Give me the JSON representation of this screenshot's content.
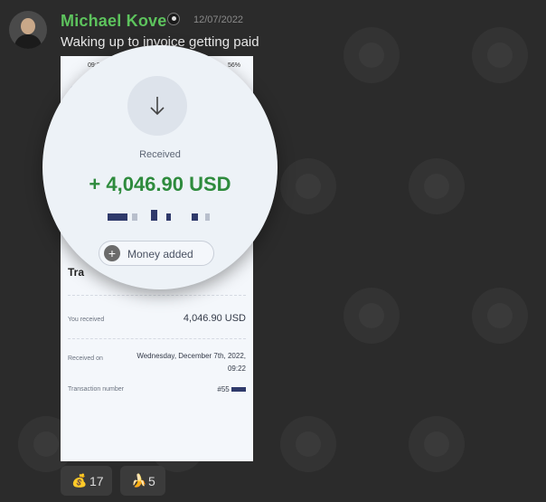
{
  "message": {
    "username": "Michael Kove",
    "timestamp": "12/07/2022",
    "text": "Waking up to invoice getting paid",
    "badge_icon": "8-ball-icon"
  },
  "screenshot": {
    "status_time": "09:22",
    "status_right": "56%",
    "received_label": "Received",
    "amount": "+ 4,046.90 USD",
    "money_added_label": "Money added",
    "transaction_title": "Tra",
    "you_received_label": "You received",
    "you_received_value": "4,046.90 USD",
    "received_on_label": "Received on",
    "received_on_value_line1": "Wednesday, December 7th, 2022,",
    "received_on_value_line2": "09:22",
    "transaction_number_label": "Transaction number",
    "transaction_number_value": "#55",
    "accent_green": "#2e8b3d"
  },
  "reactions": [
    {
      "emoji": "💰",
      "count": "17"
    },
    {
      "emoji": "🍌",
      "count": "5"
    }
  ]
}
